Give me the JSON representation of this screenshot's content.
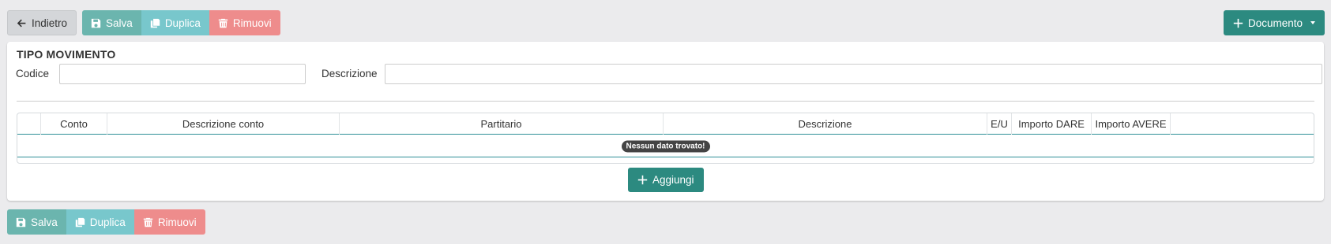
{
  "toolbar": {
    "back_label": "Indietro",
    "save_label": "Salva",
    "duplicate_label": "Duplica",
    "remove_label": "Rimuovi",
    "document_label": "Documento"
  },
  "form": {
    "title": "TIPO MOVIMENTO",
    "codice_label": "Codice",
    "codice_value": "",
    "descrizione_label": "Descrizione",
    "descrizione_value": ""
  },
  "table": {
    "columns": [
      "",
      "Conto",
      "Descrizione conto",
      "Partitario",
      "Descrizione",
      "E/U",
      "Importo DARE",
      "Importo AVERE",
      ""
    ],
    "empty_message": "Nessun dato trovato!",
    "add_label": "Aggiungi"
  },
  "colors": {
    "primary": "#2c8a80",
    "save": "#6bb5ae",
    "duplicate": "#78c7cc",
    "remove": "#ee8c8c",
    "table_border_accent": "#2f8f97"
  }
}
